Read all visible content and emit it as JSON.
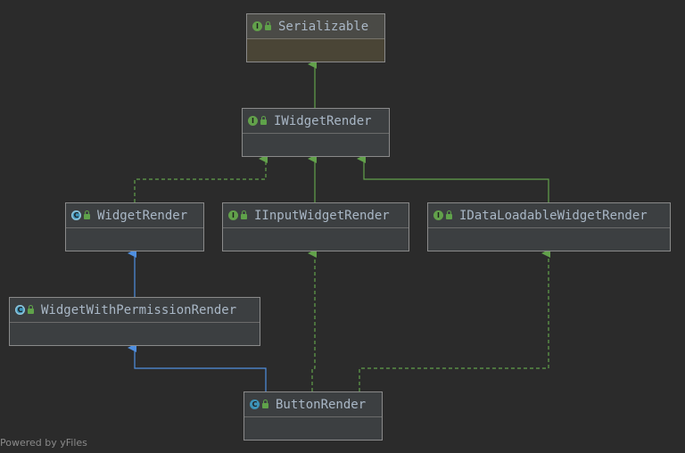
{
  "nodes": [
    {
      "id": "serializable",
      "label": "Serializable",
      "kind": "interface",
      "badge": "I"
    },
    {
      "id": "iwidgetrender",
      "label": "IWidgetRender",
      "kind": "interface",
      "badge": "I"
    },
    {
      "id": "widgetrender",
      "label": "WidgetRender",
      "kind": "abstract-class",
      "badge": "C"
    },
    {
      "id": "iinputwidgetrender",
      "label": "IInputWidgetRender",
      "kind": "interface",
      "badge": "I"
    },
    {
      "id": "idataloadablewidgetrender",
      "label": "IDataLoadableWidgetRender",
      "kind": "interface",
      "badge": "I"
    },
    {
      "id": "widgetwithpermissionrender",
      "label": "WidgetWithPermissionRender",
      "kind": "abstract-class",
      "badge": "C"
    },
    {
      "id": "buttonrender",
      "label": "ButtonRender",
      "kind": "class",
      "badge": "C"
    }
  ],
  "edges": [
    {
      "from": "iwidgetrender",
      "to": "serializable",
      "type": "extends-interface"
    },
    {
      "from": "widgetrender",
      "to": "iwidgetrender",
      "type": "implements"
    },
    {
      "from": "iinputwidgetrender",
      "to": "iwidgetrender",
      "type": "extends-interface"
    },
    {
      "from": "idataloadablewidgetrender",
      "to": "iwidgetrender",
      "type": "extends-interface"
    },
    {
      "from": "widgetwithpermissionrender",
      "to": "widgetrender",
      "type": "extends-class"
    },
    {
      "from": "buttonrender",
      "to": "widgetwithpermissionrender",
      "type": "extends-class"
    },
    {
      "from": "buttonrender",
      "to": "iinputwidgetrender",
      "type": "implements"
    },
    {
      "from": "buttonrender",
      "to": "idataloadablewidgetrender",
      "type": "implements"
    }
  ],
  "colors": {
    "interface_edge": "#62a14b",
    "class_edge": "#4f8fe0",
    "interface_badge": "#62a14b",
    "class_badge": "#3d93b8"
  },
  "footer": "Powered by yFiles"
}
